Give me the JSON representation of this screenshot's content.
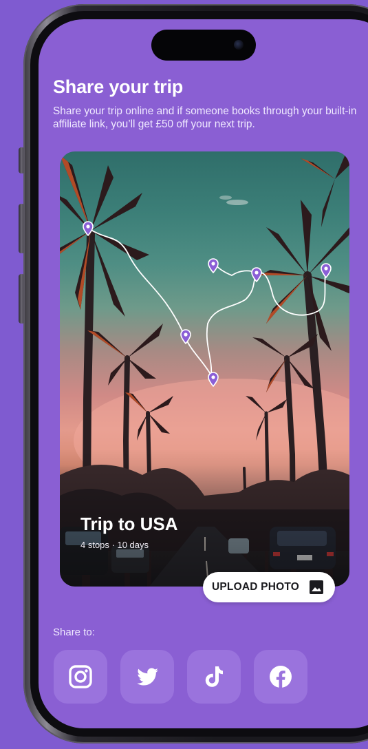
{
  "screen": {
    "title": "Share your trip",
    "subtitle": "Share your trip online and if someone books through your built-in affiliate link, you’ll get £50 off your next trip."
  },
  "trip_card": {
    "title": "Trip to USA",
    "meta": "4 stops · 10 days",
    "upload_label": "UPLOAD PHOTO",
    "upload_icon": "image-icon"
  },
  "share": {
    "label": "Share to:",
    "targets": [
      {
        "icon": "instagram-icon"
      },
      {
        "icon": "twitter-icon"
      },
      {
        "icon": "tiktok-icon"
      },
      {
        "icon": "facebook-icon"
      }
    ]
  },
  "colors": {
    "background": "#7f5bd0",
    "screen": "#8a5fd3",
    "tile": "#9a73dd",
    "map_pin": "#8b5fd6"
  }
}
